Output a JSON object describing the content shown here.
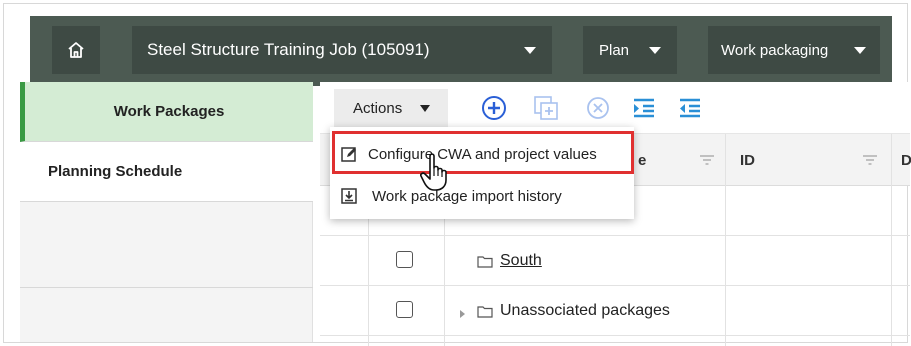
{
  "topbar": {
    "job_label": "Steel Structure Training Job (105091)",
    "plan_label": "Plan",
    "workpackaging_label": "Work packaging"
  },
  "nav": {
    "items": [
      {
        "label": "Work Packages",
        "active": true
      },
      {
        "label": "Planning Schedule",
        "active": false
      }
    ]
  },
  "toolbar": {
    "actions_label": "Actions"
  },
  "table": {
    "columns": [
      "e",
      "ID",
      "D"
    ],
    "rows": [
      {
        "name": "South",
        "link": true
      },
      {
        "name": "Unassociated packages",
        "link": false,
        "expandable": true
      }
    ]
  },
  "actions_menu": {
    "items": [
      {
        "label": "Configure CWA and project values",
        "icon": "edit-icon",
        "highlighted": true
      },
      {
        "label": "Work package import history",
        "icon": "import-history-icon"
      }
    ]
  },
  "colors": {
    "topbar_bg": "#4c5a52",
    "topbar_control_bg": "#3e4a44",
    "nav_active_bg": "#d4ecd4",
    "nav_active_border": "#3a9a44",
    "toolbar_icon": "#2a5fd6",
    "highlight_border": "#e03030"
  }
}
